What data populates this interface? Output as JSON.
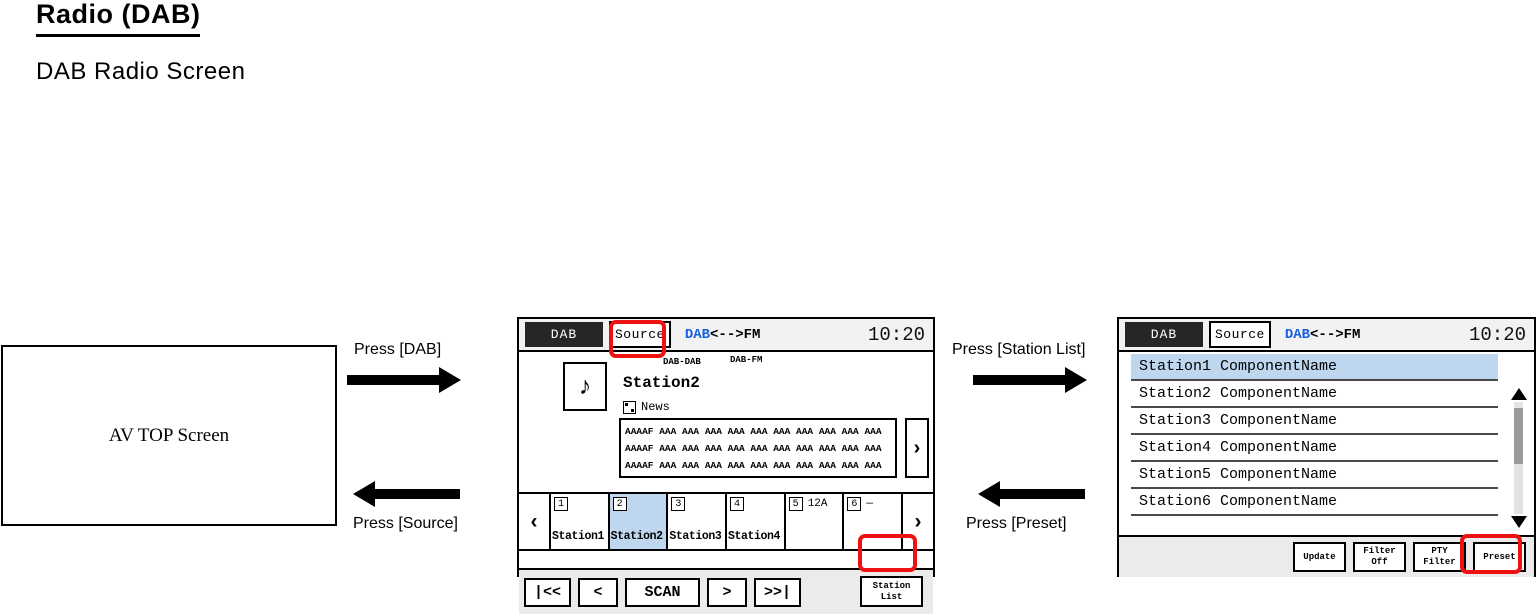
{
  "doc": {
    "title": "Radio (DAB)",
    "subtitle": "DAB Radio Screen"
  },
  "av_top": {
    "label": "AV TOP Screen"
  },
  "transitions": {
    "to_dab": "Press [DAB]",
    "to_source": "Press [Source]",
    "to_station_list": "Press [Station List]",
    "to_preset": "Press [Preset]"
  },
  "main_screen": {
    "header": {
      "source_tag": "DAB",
      "source_button": "Source",
      "band_on": "DAB",
      "band_off": "<-->FM",
      "clock": "10:20"
    },
    "note_icon": "♪",
    "mode_left": "DAB-DAB",
    "mode_right": "DAB-FM",
    "station_name": "Station2",
    "pty_label": "News",
    "radiotext_lines": [
      "AAAAF AAA AAA AAA AAA AAA AAA AAA AAA AAA AAA",
      "AAAAF AAA AAA AAA AAA AAA AAA AAA AAA AAA AAA",
      "AAAAF AAA AAA AAA AAA AAA AAA AAA AAA AAA AAA"
    ],
    "radiotext_next": "›",
    "preset_prev": "‹",
    "preset_next": "›",
    "presets": [
      {
        "num": "1",
        "label": "Station1",
        "ensemble": "",
        "selected": false
      },
      {
        "num": "2",
        "label": "Station2",
        "ensemble": "",
        "selected": true
      },
      {
        "num": "3",
        "label": "Station3",
        "ensemble": "",
        "selected": false
      },
      {
        "num": "4",
        "label": "Station4",
        "ensemble": "",
        "selected": false
      },
      {
        "num": "5",
        "label": "",
        "ensemble": "12A",
        "selected": false
      },
      {
        "num": "6",
        "label": "",
        "ensemble": "—",
        "selected": false
      }
    ],
    "controls": [
      {
        "label": "|<<",
        "width": "w-md"
      },
      {
        "label": "<",
        "width": "w-sm"
      },
      {
        "label": "SCAN",
        "width": "w-lg"
      },
      {
        "label": ">",
        "width": "w-sm"
      },
      {
        "label": ">>|",
        "width": "w-md"
      }
    ],
    "station_list_button": {
      "line1": "Station",
      "line2": "List"
    }
  },
  "list_screen": {
    "header": {
      "source_tag": "DAB",
      "source_button": "Source",
      "band_on": "DAB",
      "band_off": "<-->FM",
      "clock": "10:20"
    },
    "rows": [
      {
        "text": "Station1 ComponentName",
        "selected": true
      },
      {
        "text": "Station2 ComponentName",
        "selected": false
      },
      {
        "text": "Station3 ComponentName",
        "selected": false
      },
      {
        "text": "Station4 ComponentName",
        "selected": false
      },
      {
        "text": "Station5 ComponentName",
        "selected": false
      },
      {
        "text": "Station6 ComponentName",
        "selected": false
      }
    ],
    "buttons": [
      {
        "line1": "Update",
        "line2": ""
      },
      {
        "line1": "Filter",
        "line2": "Off"
      },
      {
        "line1": "PTY",
        "line2": "Filter"
      },
      {
        "line1": "Preset",
        "line2": ""
      }
    ]
  },
  "colors": {
    "highlight_ring": "#ee1111",
    "selection": "#bed7ef",
    "band_active": "#1a5fe0"
  }
}
